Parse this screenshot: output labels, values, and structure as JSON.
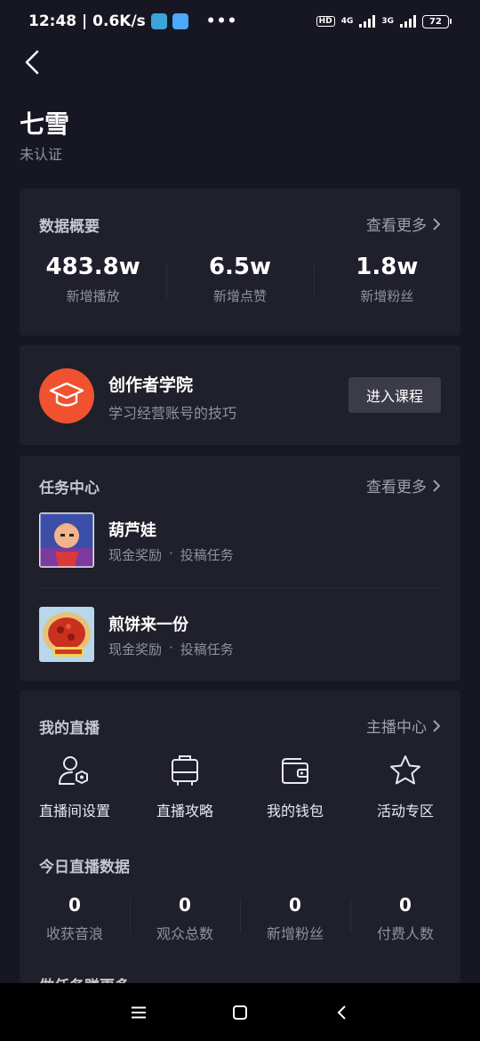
{
  "status_bar": {
    "time_speed": "12:48 | 0.6K/s",
    "dots": "•••",
    "hd": "HD",
    "net1": "4G",
    "net2": "3G",
    "battery": "72"
  },
  "profile": {
    "name": "七雪",
    "status": "未认证"
  },
  "data_overview": {
    "title": "数据概要",
    "more": "查看更多",
    "stats": [
      {
        "value": "483.8w",
        "label": "新增播放"
      },
      {
        "value": "6.5w",
        "label": "新增点赞"
      },
      {
        "value": "1.8w",
        "label": "新增粉丝"
      }
    ]
  },
  "academy": {
    "title": "创作者学院",
    "subtitle": "学习经营账号的技巧",
    "button": "进入课程"
  },
  "tasks": {
    "title": "任务中心",
    "more": "查看更多",
    "items": [
      {
        "name": "葫芦娃",
        "reward": "现金奖励",
        "sep": "·",
        "type": "投稿任务"
      },
      {
        "name": "煎饼来一份",
        "reward": "现金奖励",
        "sep": "·",
        "type": "投稿任务"
      }
    ]
  },
  "live": {
    "title": "我的直播",
    "more": "主播中心",
    "tools": [
      {
        "label": "直播间设置",
        "icon": "user-settings-icon"
      },
      {
        "label": "直播攻略",
        "icon": "suitcase-icon"
      },
      {
        "label": "我的钱包",
        "icon": "wallet-icon"
      },
      {
        "label": "活动专区",
        "icon": "star-icon"
      }
    ],
    "today_title": "今日直播数据",
    "today_stats": [
      {
        "value": "0",
        "label": "收获音浪"
      },
      {
        "value": "0",
        "label": "观众总数"
      },
      {
        "value": "0",
        "label": "新增粉丝"
      },
      {
        "value": "0",
        "label": "付费人数"
      }
    ],
    "cut_title": "做任务赚更多"
  },
  "colors": {
    "background": "#161722",
    "card": "#1f202b",
    "accent_orange": "#f0512e"
  }
}
